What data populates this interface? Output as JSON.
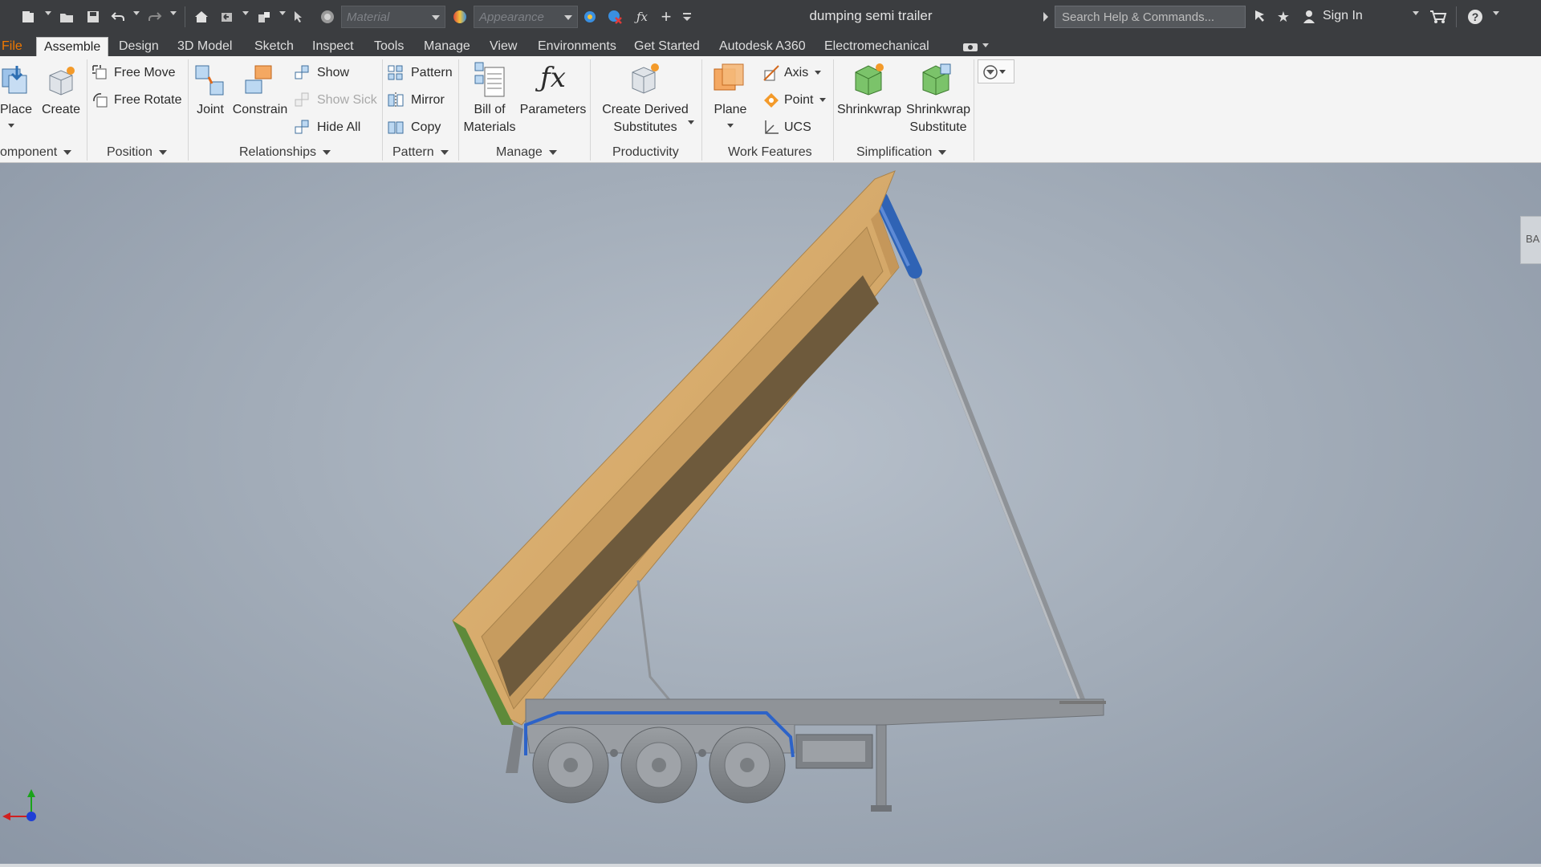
{
  "title_bar": {
    "document_title": "dumping semi trailer",
    "material_placeholder": "Material",
    "appearance_placeholder": "Appearance",
    "search_placeholder": "Search Help & Commands...",
    "sign_in": "Sign In",
    "icons": [
      "new-icon",
      "open-icon",
      "save-icon",
      "undo-icon",
      "redo-icon",
      "home-icon",
      "return-icon",
      "update-icon",
      "select-icon",
      "material-icon",
      "appearance-icon",
      "clear-override-icon",
      "fx-icon",
      "add-icon",
      "customize-icon",
      "search-chevron-icon",
      "help-download-icon",
      "favorites-icon",
      "user-icon",
      "cart-icon",
      "help-icon"
    ]
  },
  "tabs": [
    {
      "label": "File",
      "kind": "file"
    },
    {
      "label": "Assemble",
      "kind": "active"
    },
    {
      "label": "Design"
    },
    {
      "label": "3D Model"
    },
    {
      "label": "Sketch"
    },
    {
      "label": "Inspect"
    },
    {
      "label": "Tools"
    },
    {
      "label": "Manage"
    },
    {
      "label": "View"
    },
    {
      "label": "Environments"
    },
    {
      "label": "Get Started"
    },
    {
      "label": "Autodesk A360"
    },
    {
      "label": "Electromechanical"
    }
  ],
  "ribbon": {
    "component": {
      "label": "omponent",
      "place": "Place",
      "create": "Create"
    },
    "position": {
      "label": "Position",
      "free_move": "Free Move",
      "free_rotate": "Free Rotate"
    },
    "relationships": {
      "label": "Relationships",
      "joint": "Joint",
      "constrain": "Constrain",
      "show": "Show",
      "show_sick": "Show Sick",
      "hide_all": "Hide All"
    },
    "pattern": {
      "label": "Pattern",
      "pattern": "Pattern",
      "mirror": "Mirror",
      "copy": "Copy"
    },
    "manage": {
      "label": "Manage",
      "bom_line1": "Bill of",
      "bom_line2": "Materials",
      "parameters": "Parameters"
    },
    "productivity": {
      "label": "Productivity",
      "cds_line1": "Create Derived",
      "cds_line2": "Substitutes"
    },
    "work_features": {
      "label": "Work Features",
      "plane": "Plane",
      "axis": "Axis",
      "point": "Point",
      "ucs": "UCS"
    },
    "simplification": {
      "label": "Simplification",
      "shrinkwrap": "Shrinkwrap",
      "sws_line1": "Shrinkwrap",
      "sws_line2": "Substitute"
    }
  },
  "viewport": {
    "viewcube_tab": "BA",
    "model": "dumping semi trailer with tipping body raised",
    "colors": {
      "body": "#d9ac6c",
      "body_dark": "#b98d52",
      "bed_inner": "#6e5a3c",
      "cylinder": "#2f63b5",
      "chassis": "#8f9398",
      "tire": "#8a8e92",
      "frame_accent": "#2d63c8"
    }
  }
}
